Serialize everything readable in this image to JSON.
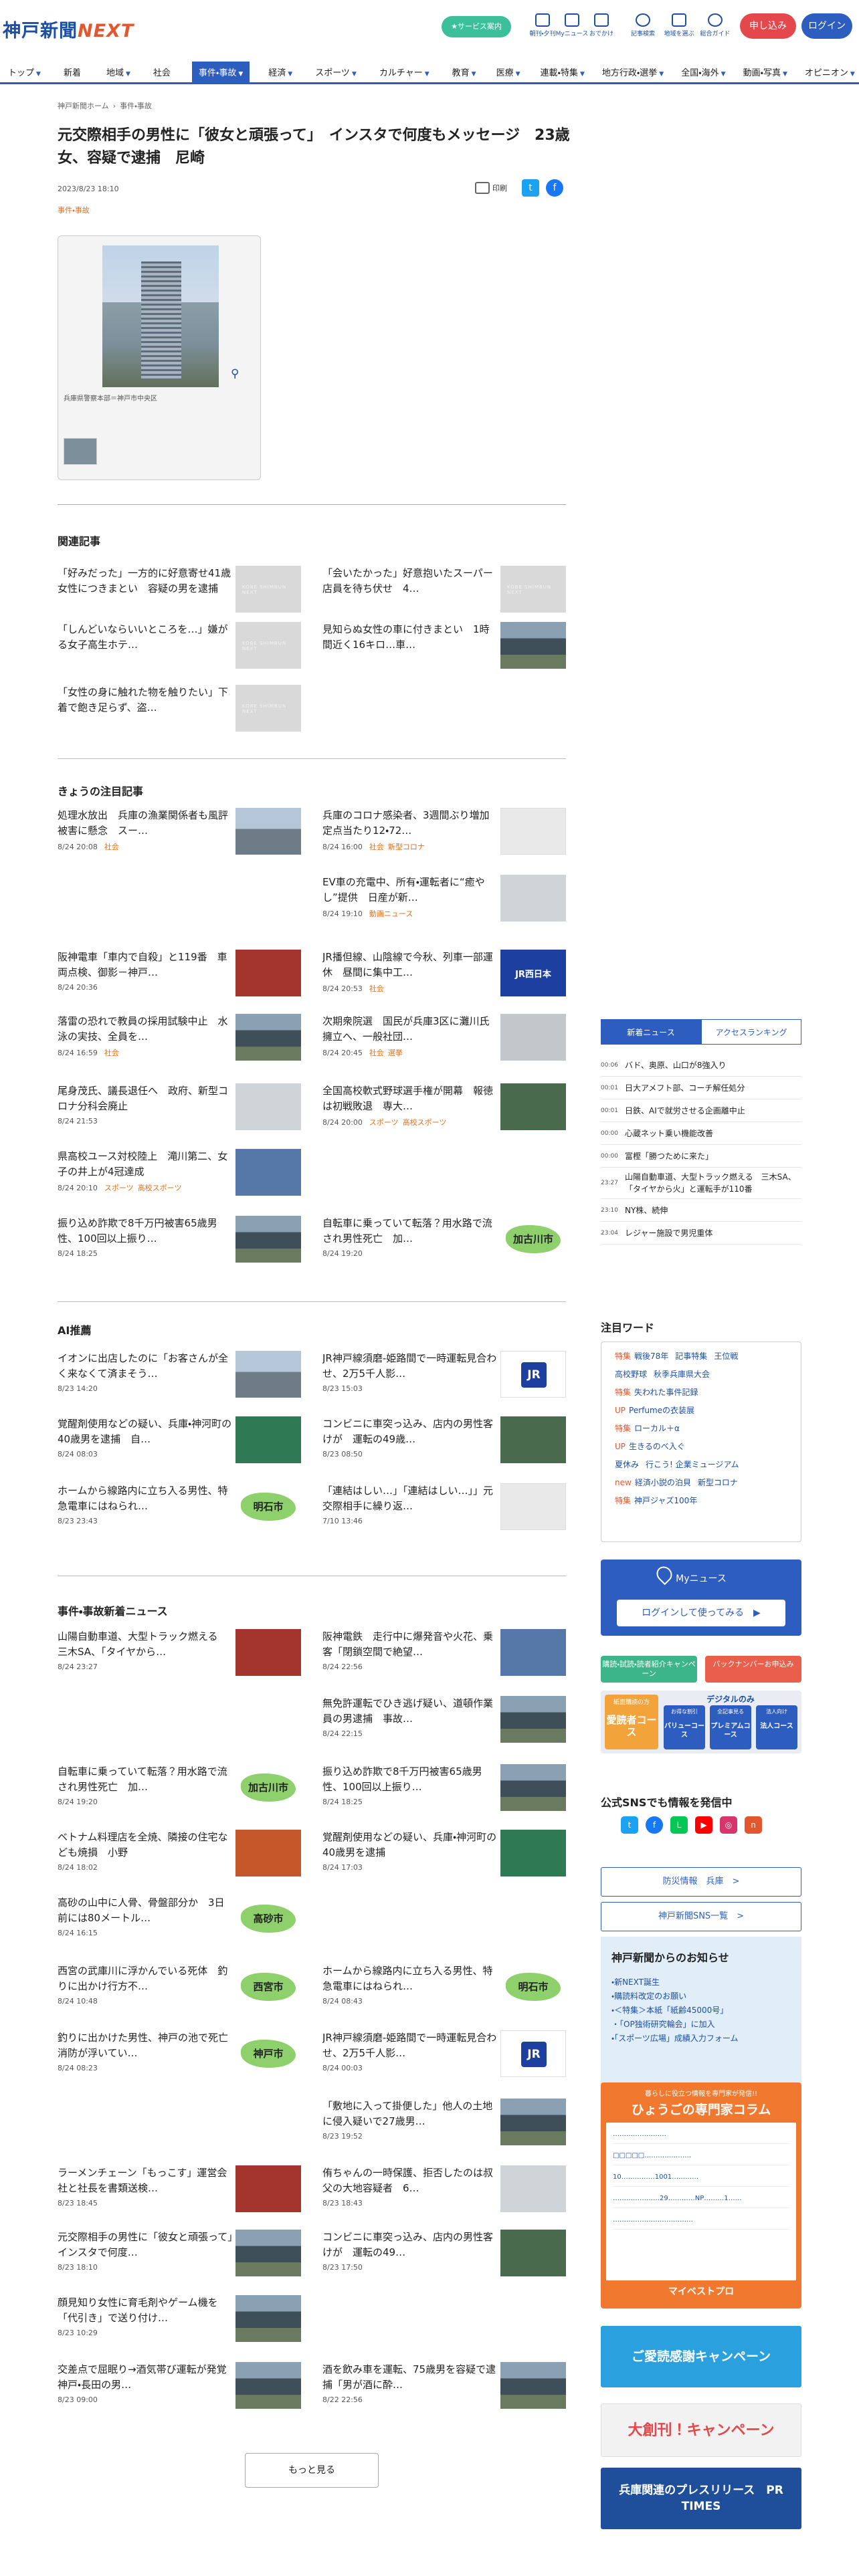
{
  "header": {
    "logo_kobe": "神戸新聞",
    "logo_next": "NEXT",
    "service_label": "★サービス案内",
    "icons": [
      {
        "label": "朝刊・夕刊",
        "icon": "newspaper-icon"
      },
      {
        "label": "Myニュース",
        "icon": "my-news-icon"
      },
      {
        "label": "おでかけ",
        "icon": "outing-icon"
      },
      {
        "label": "記事検索",
        "icon": "search-icon"
      },
      {
        "label": "地域を選ぶ",
        "icon": "map-pin-icon"
      },
      {
        "label": "総合ガイド",
        "icon": "help-icon"
      }
    ],
    "apply_label": "申し込み",
    "login_label": "ログイン"
  },
  "nav": [
    {
      "label": "トップ",
      "chevron": true
    },
    {
      "label": "新着",
      "chevron": false
    },
    {
      "label": "地域",
      "chevron": true
    },
    {
      "label": "社会",
      "chevron": false
    },
    {
      "label": "事件・事故",
      "chevron": true,
      "active": true
    },
    {
      "label": "経済",
      "chevron": true
    },
    {
      "label": "スポーツ",
      "chevron": true
    },
    {
      "label": "カルチャー",
      "chevron": true
    },
    {
      "label": "教育",
      "chevron": true
    },
    {
      "label": "医療",
      "chevron": true
    },
    {
      "label": "連載・特集",
      "chevron": true
    },
    {
      "label": "地方行政・選挙",
      "chevron": true
    },
    {
      "label": "全国・海外",
      "chevron": true
    },
    {
      "label": "動画・写真",
      "chevron": true
    },
    {
      "label": "オピニオン",
      "chevron": true
    }
  ],
  "breadcrumb": [
    "神戸新聞ホーム",
    "事件・事故"
  ],
  "article": {
    "title": "元交際相手の男性に「彼女と頑張って」　インスタで何度もメッセージ　23歳女、容疑で逮捕　尼崎",
    "date": "2023/8/23 18:10",
    "category": "事件・事故",
    "print_label": "印刷",
    "photo_caption": "兵庫県警察本部＝神戸市中央区"
  },
  "related": {
    "heading": "関連記事",
    "items": [
      {
        "title": "「好みだった」一方的に好意寄せ41歳女性につきまとい　容疑の男を逮捕",
        "img": "ph"
      },
      {
        "title": "「会いたかった」好意抱いたスーパー店員を待ち伏せ　4…",
        "img": "ph"
      },
      {
        "title": "「しんどいならいいところを…」嫌がる女子高生ホテ…",
        "img": "ph"
      },
      {
        "title": "見知らぬ女性の車に付きまとい　1時間近く16キロ…車…",
        "img": "bl"
      },
      {
        "title": "「女性の身に触れた物を触りたい」下着で飽き足らず、盗…",
        "img": "ph"
      }
    ]
  },
  "today": {
    "heading": "きょうの注目記事",
    "items": [
      {
        "title": "処理水放出　兵庫の漁業関係者も風評被害に懸念　スー…",
        "date": "8/24 20:08",
        "tags": [
          "社会"
        ],
        "img": "city"
      },
      {
        "title": "兵庫のコロナ感染者、3週間ぶり増加　定点当たり12・72…",
        "date": "8/24 16:00",
        "tags": [
          "社会",
          "新型コロナ"
        ],
        "img": "gr"
      },
      {
        "title": "EV車の充電中、所有・運転者に“癒やし”提供　日産が新…",
        "date": "8/24 19:10",
        "tags": [
          "動画ニュース"
        ],
        "img": "por"
      },
      {
        "title": "阪神電車「車内で自殺」と119番　車両点検、御影－神戸…",
        "date": "8/24 20:36",
        "tags": [],
        "img": "red"
      },
      {
        "title": "JR播但線、山陰線で今秋、列車一部運休　昼間に集中工…",
        "date": "8/24 20:53",
        "tags": [
          "社会"
        ],
        "img": "jrw"
      },
      {
        "title": "落雷の恐れで教員の採用試験中止　水泳の実技、全員を…",
        "date": "8/24 16:59",
        "tags": [
          "社会"
        ],
        "img": "bl"
      },
      {
        "title": "次期衆院選　国民が兵庫3区に灘川氏擁立へ、一般社団…",
        "date": "8/24 20:45",
        "tags": [
          "社会",
          "選挙"
        ],
        "img": "hp"
      },
      {
        "title": "尾身茂氏、議長退任へ　政府、新型コロナ分科会廃止",
        "date": "8/24 21:53",
        "tags": [],
        "img": "por"
      },
      {
        "title": "全国高校軟式野球選手権が開幕　報徳は初戦敗退　専大…",
        "date": "8/24 20:00",
        "tags": [
          "スポーツ",
          "高校スポーツ"
        ],
        "img": "stn"
      },
      {
        "title": "県高校ユース対校陸上　滝川第二、女子の井上が4冠達成",
        "date": "8/24 20:10",
        "tags": [
          "スポーツ",
          "高校スポーツ"
        ],
        "img": "sc"
      },
      {
        "title": "振り込め詐欺で8千万円被害65歳男性、100回以上振り…",
        "date": "8/24 18:25",
        "tags": [],
        "img": "bl"
      },
      {
        "title": "自転車に乗っていて転落？用水路で流され男性死亡　加…",
        "date": "8/24 19:20",
        "tags": [],
        "img": "map",
        "place": "加古川市"
      }
    ]
  },
  "ai": {
    "heading": "AI推薦",
    "items": [
      {
        "title": "イオンに出店したのに「お客さんが全く来なくて済まそう…",
        "date": "8/23 14:20",
        "img": "city"
      },
      {
        "title": "JR神戸線須磨-姫路間で一時運転見合わせ、2万5千人影…",
        "date": "8/23 15:03",
        "img": "jr"
      },
      {
        "title": "覚醒剤使用などの疑い、兵庫・神河町の40歳男を逮捕　自…",
        "date": "8/24 08:03",
        "img": "grn"
      },
      {
        "title": "コンビニに車突っ込み、店内の男性客けが　運転の49歳…",
        "date": "8/23 08:50",
        "img": "stn"
      },
      {
        "title": "ホームから線路内に立ち入る男性、特急電車にはねられ…",
        "date": "8/23 23:43",
        "img": "map",
        "place": "明石市"
      },
      {
        "title": "「連結はしい…」「連結はしい…」」元交際相手に繰り返…",
        "date": "7/10 13:46",
        "img": "gr"
      }
    ]
  },
  "latest": {
    "heading": "事件・事故新着ニュース",
    "items": [
      {
        "title": "山陽自動車道、大型トラック燃える　三木SA、「タイヤから…",
        "date": "8/24 23:27",
        "img": "red"
      },
      {
        "title": "阪神電鉄　走行中に爆発音や火花、乗客「閉鎖空間で絶望…",
        "date": "8/24 22:56",
        "img": "sc"
      },
      {
        "title": "無免許運転でひき逃げ疑い、道頓作業員の男逮捕　事故…",
        "date": "8/24 22:15",
        "img": "bl"
      },
      {
        "title": "自転車に乗っていて転落？用水路で流され男性死亡　加…",
        "date": "8/24 19:20",
        "img": "map",
        "place": "加古川市"
      },
      {
        "title": "振り込め詐欺で8千万円被害65歳男性、100回以上振り…",
        "date": "8/24 18:25",
        "img": "bl"
      },
      {
        "title": "ベトナム料理店を全焼、隣接の住宅なども焼損　小野",
        "date": "8/24 18:02",
        "img": "fire"
      },
      {
        "title": "覚醒剤使用などの疑い、兵庫・神河町の40歳男を逮捕",
        "date": "8/24 17:03",
        "img": "grn"
      },
      {
        "title": "高砂の山中に人骨、骨盤部分か　3日前には80メートル…",
        "date": "8/24 16:15",
        "img": "map",
        "place": "高砂市"
      },
      {
        "title": "西宮の武庫川に浮かんでいる死体　釣りに出かけ行方不…",
        "date": "8/24 10:48",
        "img": "map",
        "place": "西宮市"
      },
      {
        "title": "ホームから線路内に立ち入る男性、特急電車にはねられ…",
        "date": "8/24 08:43",
        "img": "map",
        "place": "明石市"
      },
      {
        "title": "釣りに出かけた男性、神戸の池で死亡　消防が浮いてい…",
        "date": "8/24 08:23",
        "img": "map",
        "place": "神戸市"
      },
      {
        "title": "JR神戸線須磨-姫路間で一時運転見合わせ、2万5千人影…",
        "date": "8/24 00:03",
        "img": "jr"
      },
      {
        "title": "「敷地に入って掛便した」他人の土地に侵入疑いで27歳男…",
        "date": "8/23 19:52",
        "img": "bl"
      },
      {
        "title": "ラーメンチェーン「もっこす」運営会社と社長を書類送検…",
        "date": "8/23 18:45",
        "img": "red"
      },
      {
        "title": "侑ちゃんの一時保護、拒否したのは叔父の大地容疑者　6…",
        "date": "8/23 18:43",
        "img": "por"
      },
      {
        "title": "元交際相手の男性に「彼女と頑張って」　インスタで何度…",
        "date": "8/23 18:10",
        "img": "bl"
      },
      {
        "title": "コンビニに車突っ込み、店内の男性客けが　運転の49…",
        "date": "8/23 17:50",
        "img": "stn"
      },
      {
        "title": "顔見知り女性に育毛剤やゲーム機を「代引き」で送り付け…",
        "date": "8/23 10:29",
        "img": "bl"
      },
      {
        "title": "交差点で屈眠り→酒気帯び運転が発覚　神戸・長田の男…",
        "date": "8/23 09:00",
        "img": "bl"
      },
      {
        "title": "酒を飲み車を運転、75歳男を容疑で逮捕「男が酒に酔…",
        "date": "8/22 22:56",
        "img": "bl"
      }
    ],
    "more_label": "もっと見る"
  },
  "sidebar": {
    "tab_new": "新着ニュース",
    "tab_rank": "アクセスランキング",
    "news": [
      {
        "time": "00:06",
        "text": "バド、奥原、山口が8強入り"
      },
      {
        "time": "00:01",
        "text": "日大アメフト部、コーチ解任処分"
      },
      {
        "time": "00:01",
        "text": "日鉄、AIで就労させる企画離中止"
      },
      {
        "time": "00:00",
        "text": "心蔵ネット乗い機能改善"
      },
      {
        "time": "00:00",
        "text": "富樫「勝つために来た」"
      },
      {
        "time": "23:27",
        "text": "山陽自動車道、大型トラック燃える　三木SA、「タイヤから火」と運転手が110番"
      },
      {
        "time": "23:10",
        "text": "NY株、続伸"
      },
      {
        "time": "23:04",
        "text": "レジャー施設で男児重体"
      }
    ],
    "keyword_heading": "注目ワード",
    "keywords": [
      {
        "pre": "特集",
        "words": [
          "戦後78年",
          "記事特集",
          "王位戦"
        ]
      },
      {
        "pre": "",
        "words": [
          "高校野球",
          "秋季兵庫県大会"
        ]
      },
      {
        "pre": "特集",
        "words": [
          "失われた事件記録"
        ]
      },
      {
        "pre": "UP",
        "words": [
          "Perfumeの衣装展"
        ]
      },
      {
        "pre": "特集",
        "words": [
          "ローカル＋α"
        ]
      },
      {
        "pre": "UP",
        "words": [
          "生きるのべ入ぐ"
        ]
      },
      {
        "pre": "",
        "words": [
          "夏休み",
          "行こう! 企業ミュージアム"
        ]
      },
      {
        "pre": "new",
        "words": [
          "経済小説の泊貝",
          "新型コロナ"
        ]
      },
      {
        "pre": "特集",
        "words": [
          "神戸ジャズ100年"
        ]
      }
    ],
    "mynews_label": "Myニュース",
    "mynews_button": "ログインして使ってみる　▶",
    "promo_campaign": "購読・試読・読者紹介キャンペーン",
    "promo_backnumber": "バックナンバーお申込み",
    "course_paper": "紙面購読の方",
    "course_paper_name": "愛読者コース",
    "course_digital": "デジタルのみ",
    "course_value_tag": "お得な割引",
    "course_value": "バリューコース",
    "course_premium_tag": "全記事見る",
    "course_premium": "プレミアムコース",
    "course_corp_tag": "法人向け",
    "course_corp": "法人コース",
    "sns_heading": "公式SNSでも情報を発信中",
    "sns_button_1": "防災情報　兵庫　>",
    "sns_button_2": "神戸新聞SNS一覧　>",
    "notice_heading": "神戸新聞からのお知らせ",
    "notices": [
      "・新NEXT誕生",
      "・購読料改定のお願い",
      "・＜特集＞本紙「紙齢45000号」",
      "・「OP独術研究輪会」に加入",
      "・「スポーツ広場」成績入力フォーム"
    ],
    "column_sub": "暮らしに役立つ情報を専門家が発信!!",
    "column_title": "ひょうごの専門家コラム",
    "column_rows": [
      "……………………",
      "□□□□□…………………",
      "10……………1001…………",
      "…………………29…………NP………1……",
      "………………………………"
    ],
    "column_footer": "マイベストプロ",
    "banner1": "ご愛読感謝キャンペーン",
    "banner2": "大創刊！キャンペーン",
    "banner3": "兵庫関連のプレスリリース　PR TIMES"
  }
}
